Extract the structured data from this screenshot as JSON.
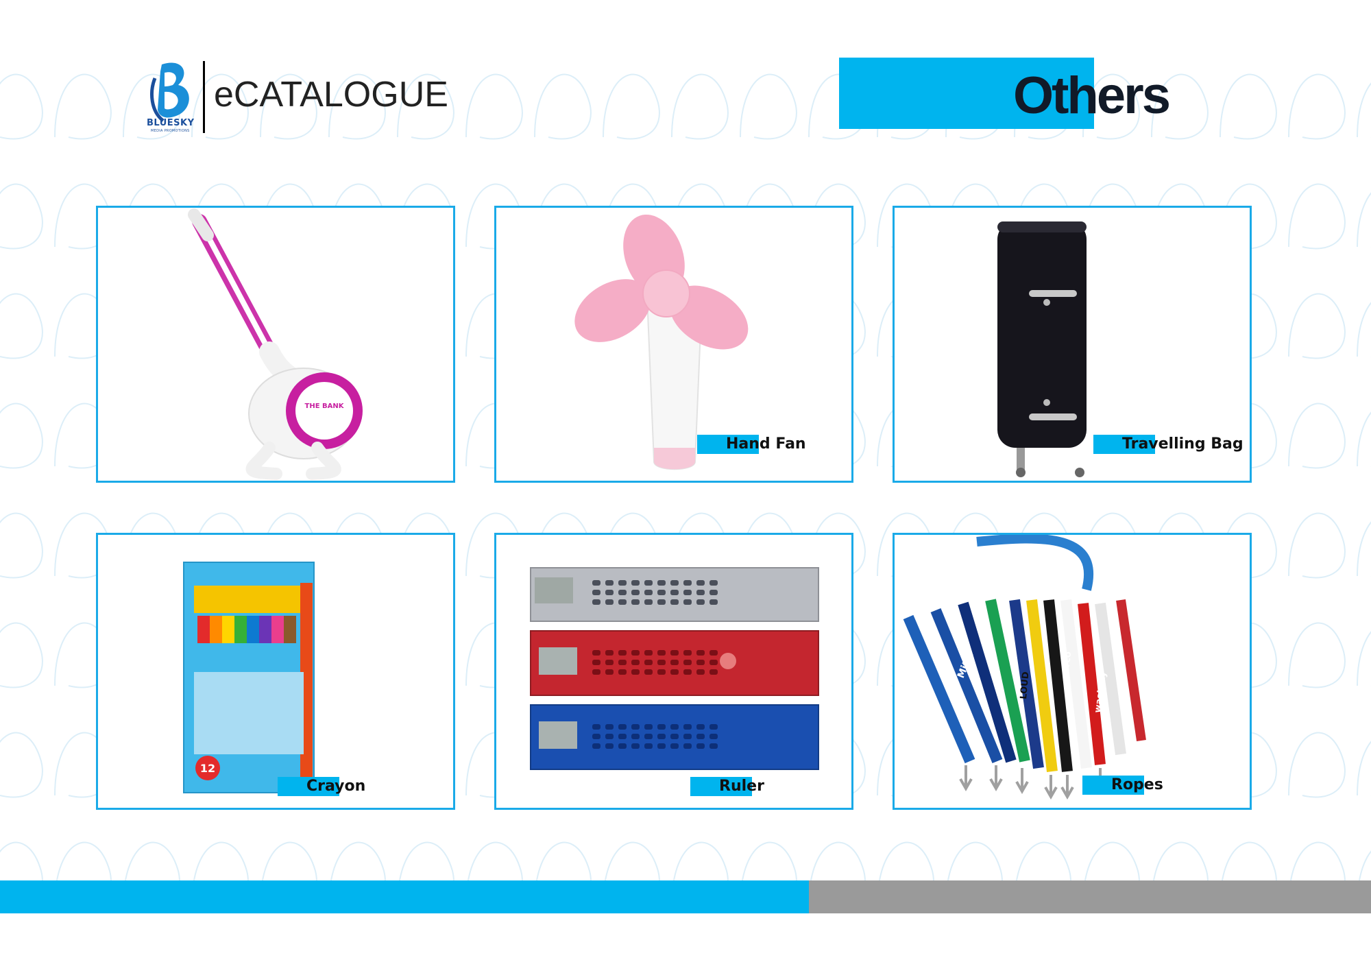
{
  "header": {
    "brand_name": "BLUESKY",
    "brand_tagline": "MEDIA PROMOTIONS",
    "catalogue_title": "eCATALOGUE",
    "section_title": "Others"
  },
  "products": [
    {
      "label": "",
      "icon": "desk-pen-icon"
    },
    {
      "label": "Hand Fan",
      "icon": "hand-fan-icon"
    },
    {
      "label": "Travelling Bag",
      "icon": "travelling-bag-icon"
    },
    {
      "label": "Crayon",
      "icon": "crayon-box-icon"
    },
    {
      "label": "Ruler",
      "icon": "calculator-ruler-icon"
    },
    {
      "label": "Ropes",
      "icon": "lanyard-ropes-icon"
    }
  ],
  "product_art_text": {
    "pen_badge": "THE BANK",
    "crayon_count": "12",
    "lanyard_brands": [
      "Miter",
      "LOUD",
      "serco",
      "wastaky"
    ]
  },
  "colors": {
    "accent": "#00b4ee",
    "card_border": "#1aaae8",
    "footer_gray": "#9a9a9a",
    "title_dark": "#111a28"
  }
}
